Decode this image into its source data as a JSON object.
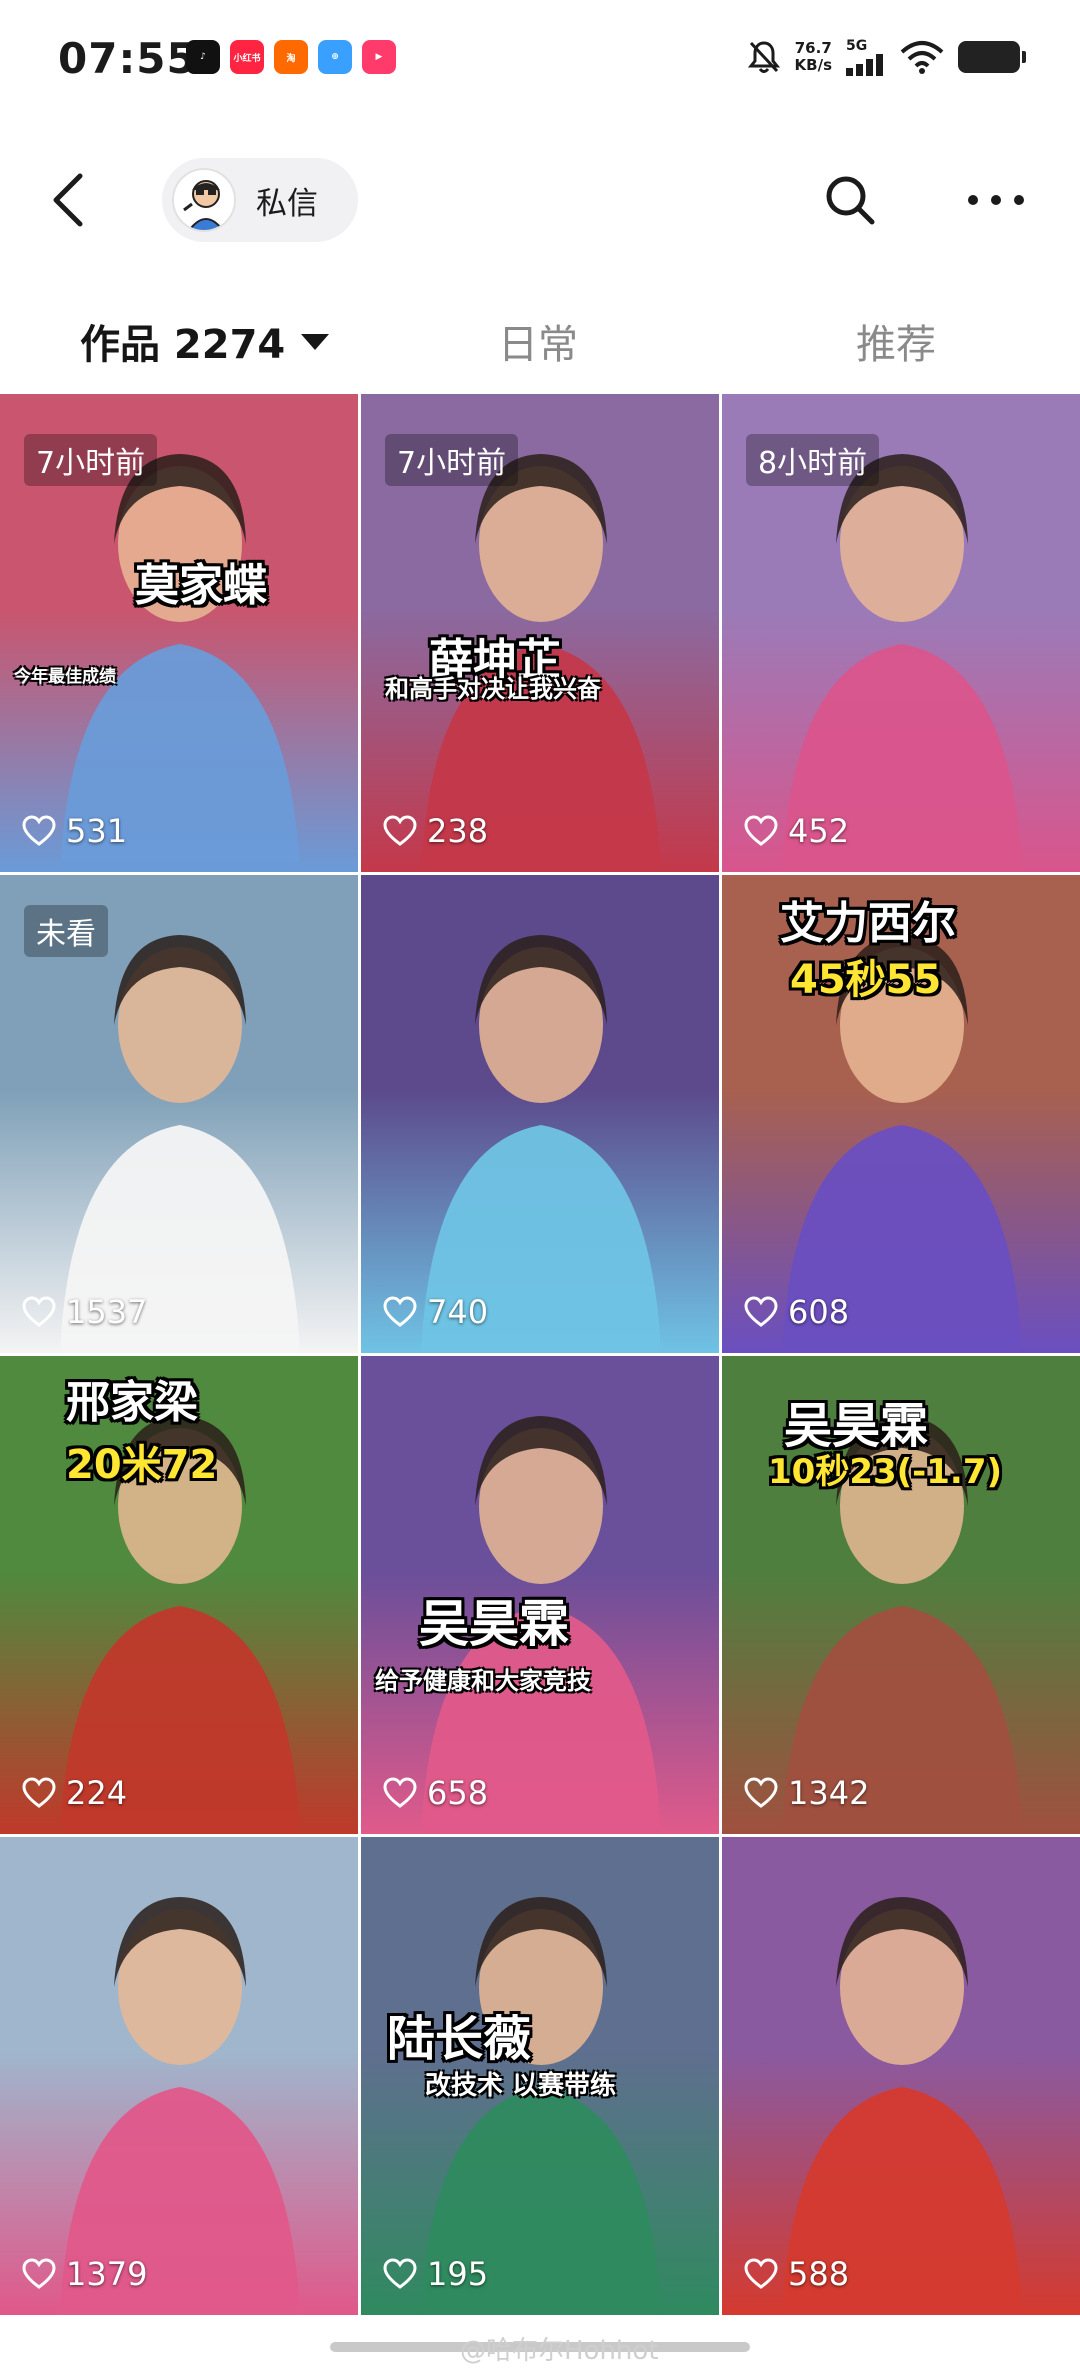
{
  "status_bar": {
    "time": "07:55",
    "apps": [
      {
        "name": "tiktok-icon",
        "color": "#111111",
        "label": "♪"
      },
      {
        "name": "xiaohongshu-icon",
        "color": "#ff2442",
        "label": "小红书"
      },
      {
        "name": "taobao-icon",
        "color": "#ff6a00",
        "label": "淘"
      },
      {
        "name": "app-icon",
        "color": "#3aa0ff",
        "label": "⊕"
      },
      {
        "name": "video-app-icon",
        "color": "#ff3b6b",
        "label": "▶"
      }
    ],
    "net_speed_value": "76.7",
    "net_speed_unit": "KB/s",
    "network": "5G"
  },
  "nav": {
    "chat_label": "私信"
  },
  "tabs": {
    "works_label": "作品 2274",
    "daily_label": "日常",
    "recommend_label": "推荐"
  },
  "videos": [
    {
      "badge": "7小时前",
      "caption": "莫家蝶",
      "subcaption": "今年最佳成绩",
      "likes": "531",
      "bg": "#c9556e",
      "bg2": "#6a9bd8"
    },
    {
      "badge": "7小时前",
      "caption": "薛坤芷",
      "subcaption": "和高手对决让我兴奋",
      "likes": "238",
      "bg": "#8a6aa0",
      "bg2": "#c4384a"
    },
    {
      "badge": "8小时前",
      "caption": "",
      "subcaption": "",
      "likes": "452",
      "bg": "#9a7bb8",
      "bg2": "#d9558c"
    },
    {
      "badge": "未看",
      "caption": "",
      "subcaption": "",
      "likes": "1537",
      "bg": "#7fa0b8",
      "bg2": "#f4f4f4"
    },
    {
      "badge": "",
      "caption": "",
      "subcaption": "",
      "likes": "740",
      "bg": "#5c4a8c",
      "bg2": "#6fc3e4"
    },
    {
      "badge": "",
      "caption": "艾力西尔",
      "caption2": "45秒55",
      "subcaption": "",
      "likes": "608",
      "bg": "#a8604f",
      "bg2": "#6a4fc0"
    },
    {
      "badge": "",
      "caption": "邢家梁",
      "caption2": "20米72",
      "subcaption": "",
      "likes": "224",
      "bg": "#4f8a3f",
      "bg2": "#c0392b"
    },
    {
      "badge": "",
      "caption": "吴昊霖",
      "subcaption": "给予健康和大家竞技",
      "likes": "658",
      "bg": "#6a4f9a",
      "bg2": "#e05a8a"
    },
    {
      "badge": "",
      "caption": "吴昊霖",
      "caption2": "10秒23(-1.7)",
      "subcaption": "",
      "likes": "1342",
      "bg": "#4f7f3f",
      "bg2": "#a0503f"
    },
    {
      "badge": "",
      "caption": "",
      "subcaption": "",
      "likes": "1379",
      "bg": "#9fb6cc",
      "bg2": "#e0588a"
    },
    {
      "badge": "",
      "caption": "陆长薇",
      "subcaption": "改技术 以赛带练",
      "likes": "195",
      "bg": "#5f6f8f",
      "bg2": "#2f8a5f"
    },
    {
      "badge": "",
      "caption": "",
      "subcaption": "",
      "likes": "588",
      "bg": "#8a5aa0",
      "bg2": "#d43a2f"
    }
  ],
  "watermark": "@哈布尔Hohhot"
}
